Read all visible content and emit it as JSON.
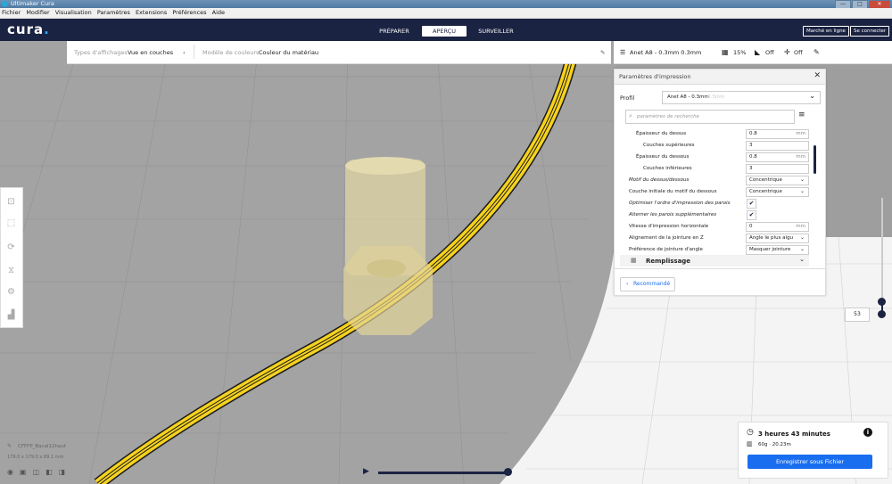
{
  "window": {
    "title": "Ultimaker Cura",
    "controls": [
      "—",
      "□",
      "✕"
    ]
  },
  "menubar": [
    "Fichier",
    "Modifier",
    "Visualisation",
    "Paramètres",
    "Extensions",
    "Préférences",
    "Aide"
  ],
  "header": {
    "logo": "cura",
    "logo_dot": ".",
    "stages": [
      "PRÉPARER",
      "APERÇU",
      "SURVEILLER"
    ],
    "active_stage": "APERÇU",
    "marketplace_label": "Marché en ligne",
    "login_label": "Se connecter"
  },
  "view_options": {
    "view_type_label": "Types d'affichages",
    "view_type_value": "Vue en couches",
    "color_scheme_label": "Modèle de couleurs",
    "color_scheme_value": "Couleur du matériau"
  },
  "print_setup": {
    "profile_summary": "Anet A8 - 0.3mm 0.3mm",
    "infill": "15%",
    "support": "Off",
    "adhesion": "Off"
  },
  "settings_panel": {
    "title": "Paramètres d'impression",
    "profile_label": "Profil",
    "profile_value": "Anet A8 - 0.3mm",
    "profile_hint": "0.3mm",
    "search_placeholder": "paramètres de recherche",
    "rows": [
      {
        "label": "Épaisseur du dessus",
        "value": "0.8",
        "unit": "mm",
        "indent": 1,
        "type": "number"
      },
      {
        "label": "Couches supérieures",
        "value": "3",
        "unit": "",
        "indent": 2,
        "type": "number"
      },
      {
        "label": "Épaisseur du dessous",
        "value": "0.8",
        "unit": "mm",
        "indent": 1,
        "type": "number"
      },
      {
        "label": "Couches inférieures",
        "value": "3",
        "unit": "",
        "indent": 2,
        "type": "number"
      },
      {
        "label": "Motif du dessus/dessous",
        "value": "Concentrique",
        "unit": "",
        "indent": 0,
        "type": "select",
        "italic": true
      },
      {
        "label": "Couche initiale du motif du dessous",
        "value": "Concentrique",
        "unit": "",
        "indent": 0,
        "type": "select"
      },
      {
        "label": "Optimiser l'ordre d'impression des parois",
        "value": "✔",
        "unit": "",
        "indent": 0,
        "type": "check",
        "italic": true
      },
      {
        "label": "Alterner les parois supplémentaires",
        "value": "✔",
        "unit": "",
        "indent": 0,
        "type": "check",
        "italic": true
      },
      {
        "label": "Vitesse d'impression horizontale",
        "value": "0",
        "unit": "mm",
        "indent": 0,
        "type": "number"
      },
      {
        "label": "Alignement de la jointure en Z",
        "value": "Angle le plus aigu",
        "unit": "",
        "indent": 0,
        "type": "select"
      },
      {
        "label": "Préférence de jointure d'angle",
        "value": "Masquer jointure",
        "unit": "",
        "indent": 0,
        "type": "select"
      }
    ],
    "section_label": "Remplissage",
    "recommended_label": "Recommandé"
  },
  "estimate": {
    "time": "3 heures 43 minutes",
    "material": "60g · 20.23m",
    "save_label": "Enregistrer sous Fichier"
  },
  "object_info": {
    "name": "CFFFP_Bacal12haut",
    "dimensions": "179.0 x 179.0 x 89.1 mm"
  },
  "layer_slider": {
    "current_layer": "53"
  },
  "colors": {
    "header": "#1b2342",
    "accent": "#196ef0",
    "filament": "#f5d21e"
  }
}
